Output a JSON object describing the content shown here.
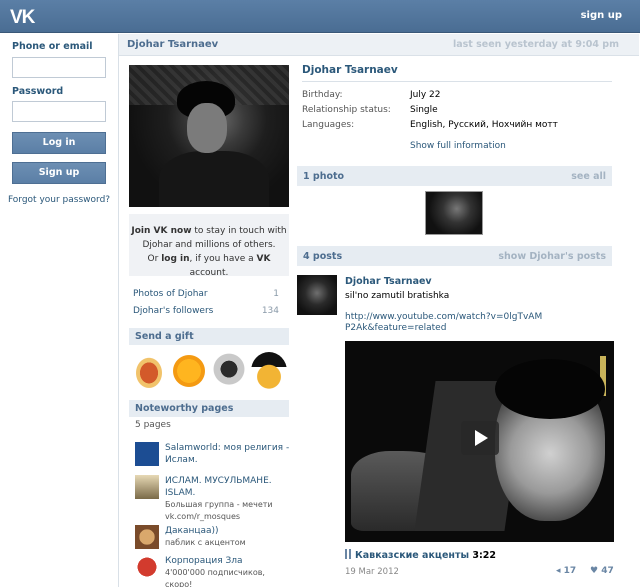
{
  "header": {
    "logo": "VK",
    "signup": "sign up"
  },
  "login": {
    "email_label": "Phone or email",
    "email_value": "",
    "password_label": "Password",
    "password_value": "",
    "login_button": "Log in",
    "signup_button": "Sign up",
    "forgot": "Forgot your password?"
  },
  "profile": {
    "name": "Djohar Tsarnaev",
    "last_seen": "last seen yesterday at 9:04 pm",
    "join": {
      "line1a": "Join VK now",
      "line1b": " to stay in touch with",
      "line2": "Djohar and millions of others.",
      "line3a": "Or ",
      "line3b": "log in",
      "line3c": ", if you have a ",
      "line3d": "VK",
      "line3e": " account."
    },
    "counts": [
      {
        "label": "Photos of Djohar",
        "value": "1"
      },
      {
        "label": "Djohar's followers",
        "value": "134"
      }
    ],
    "gift_title": "Send a gift",
    "gifts": [
      "hotdog-gift",
      "sun-gift",
      "sheep-gift",
      "gentleman-gift"
    ],
    "pages_title": "Noteworthy pages",
    "pages_count": "5 pages",
    "pages": [
      {
        "title": "Salamworld: моя религия - Ислам.",
        "sub": ""
      },
      {
        "title": "ИСЛАМ. МУСУЛЬМАНЕ. ISLAM.",
        "sub": "Большая группа - мечети vk.com/r_mosques"
      },
      {
        "title": "Даканцаа))",
        "sub": "паблик с акцентом"
      },
      {
        "title": "Корпорация Зла",
        "sub": "4'000'000 подписчиков, скоро!"
      }
    ],
    "info": [
      {
        "label": "Birthday:",
        "value": "July 22"
      },
      {
        "label": "Relationship status:",
        "value": "Single"
      },
      {
        "label": "Languages:",
        "value": "English, Русский, Нохчийн мотт"
      }
    ],
    "show_full": "Show full information",
    "photos_bar": {
      "label": "1 photo",
      "action": "see all"
    },
    "posts_bar": {
      "label": "4 posts",
      "action": "show Djohar's posts"
    }
  },
  "post": {
    "author": "Djohar Tsarnaev",
    "text": "sil'no zamutil bratishka",
    "link": "http://www.youtube.com/watch?v=0lgTvAMP2Ak&feature=related",
    "video_title": "Кавказские акценты",
    "video_duration": "3:22",
    "date": "19 Mar 2012",
    "shares": "17",
    "likes": "47"
  }
}
